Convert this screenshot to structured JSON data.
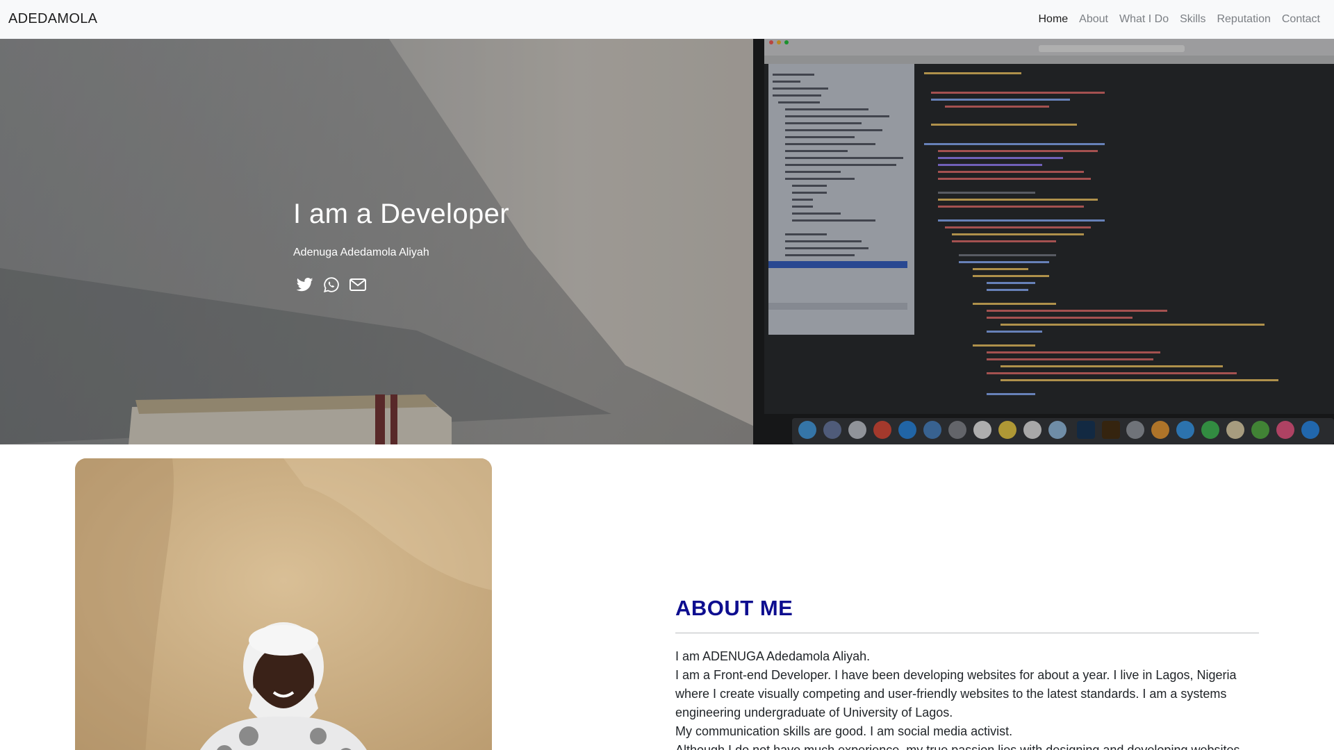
{
  "navbar": {
    "brand": "ADEDAMOLA",
    "links": [
      {
        "label": "Home",
        "active": true
      },
      {
        "label": "About",
        "active": false
      },
      {
        "label": "What I Do",
        "active": false
      },
      {
        "label": "Skills",
        "active": false
      },
      {
        "label": "Reputation",
        "active": false
      },
      {
        "label": "Contact",
        "active": false
      }
    ]
  },
  "hero": {
    "title": "I am a Developer",
    "subtitle": "Adenuga Adedamola Aliyah",
    "icons": [
      "twitter-icon",
      "whatsapp-icon",
      "envelope-icon"
    ]
  },
  "about": {
    "heading": "ABOUT ME",
    "paragraphs": [
      "I am ADENUGA Adedamola Aliyah.",
      "I am a Front-end Developer. I have been developing websites for about a year. I live in Lagos, Nigeria where I create visually competing and user-friendly websites to the latest standards. I am a systems engineering undergraduate of University of Lagos.",
      "My communication skills are good. I am social media activist.",
      "Although I do not have much experience, my true passion lies with designing and developing websites."
    ]
  },
  "colors": {
    "navbar_bg": "#f8f9fa",
    "accent_heading": "#0d0d8f",
    "nav_active": "#1d1d1d",
    "nav_inactive": "#7b7f84"
  }
}
